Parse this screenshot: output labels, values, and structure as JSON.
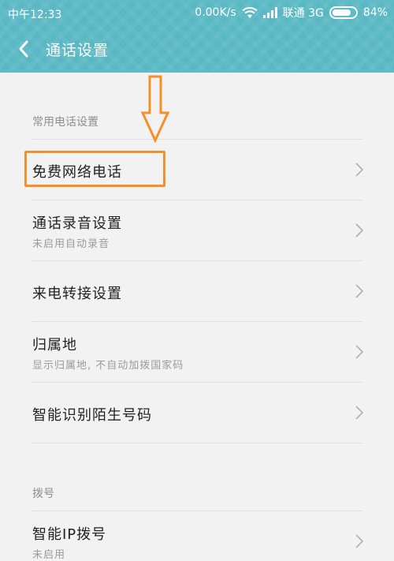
{
  "status_bar": {
    "time": "中午12:33",
    "network_speed": "0.00K/s",
    "carrier": "联通 3G",
    "battery": "84%",
    "icons": [
      "wifi-icon",
      "signal-icon",
      "battery-icon"
    ]
  },
  "navbar": {
    "back_icon": "chevron-left-icon",
    "title": "通话设置"
  },
  "sections": [
    {
      "header": "常用电话设置",
      "items": [
        {
          "title": "免费网络电话",
          "subtitle": ""
        },
        {
          "title": "通话录音设置",
          "subtitle": "未启用自动录音"
        },
        {
          "title": "来电转接设置",
          "subtitle": ""
        },
        {
          "title": "归属地",
          "subtitle": "显示归属地, 不自动加拨国家码"
        },
        {
          "title": "智能识别陌生号码",
          "subtitle": ""
        }
      ]
    },
    {
      "header": "拨号",
      "items": [
        {
          "title": "智能IP拨号",
          "subtitle": "未启用"
        }
      ]
    }
  ],
  "colors": {
    "header_bg": "#5ab8c4",
    "annotation": "#f4902a",
    "page_bg": "#f2f2f2"
  }
}
